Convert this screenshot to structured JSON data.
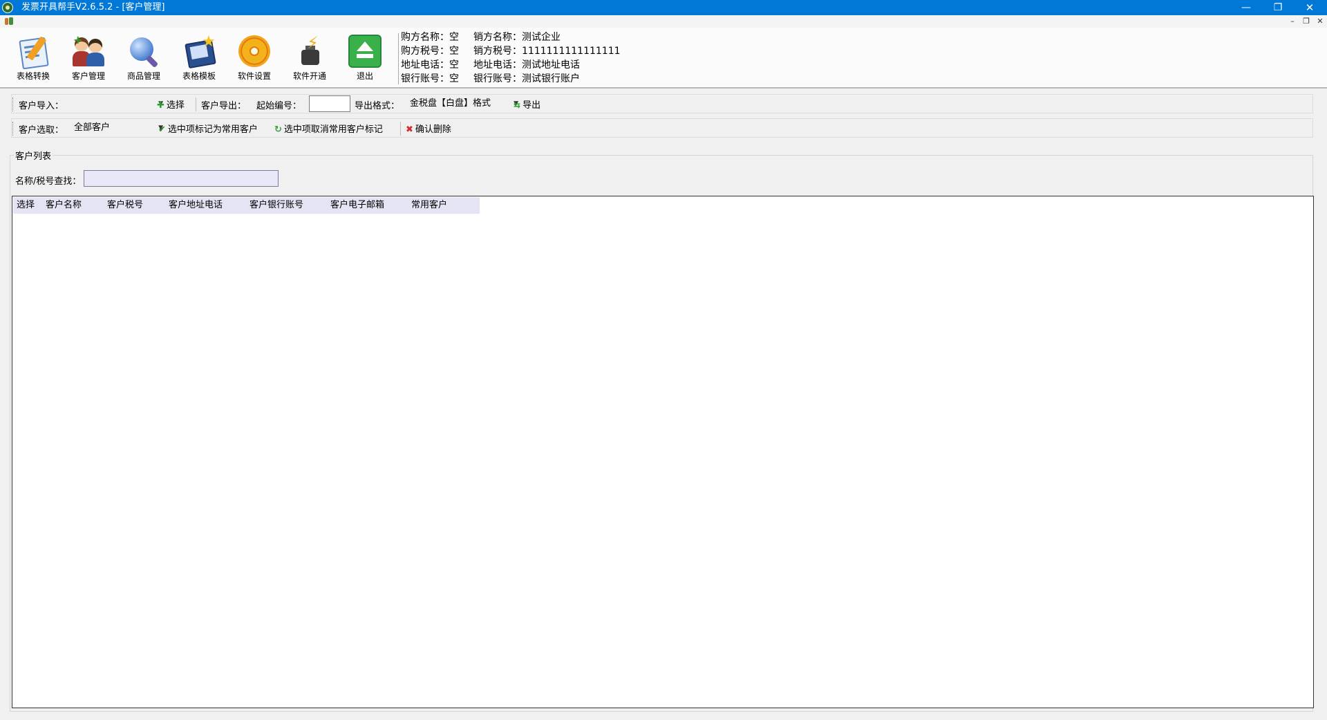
{
  "window": {
    "title": "发票开具帮手V2.6.5.2  - [客户管理]",
    "minimize_glyph": "—",
    "maximize_glyph": "❐",
    "close_glyph": "✕"
  },
  "mdi": {
    "min": "–",
    "restore": "❐",
    "close": "✕"
  },
  "toolbar": {
    "buttons": [
      {
        "label": "表格转换",
        "icon": "sheet-convert-icon"
      },
      {
        "label": "客户管理",
        "icon": "client-icon"
      },
      {
        "label": "商品管理",
        "icon": "goods-icon"
      },
      {
        "label": "表格模板",
        "icon": "template-icon"
      },
      {
        "label": "软件设置",
        "icon": "settings-gear-icon"
      },
      {
        "label": "软件开通",
        "icon": "activate-icon"
      },
      {
        "label": "退出",
        "icon": "exit-icon"
      }
    ]
  },
  "info": {
    "buyer": [
      {
        "label": "购方名称：",
        "value": "空"
      },
      {
        "label": "购方税号：",
        "value": "空"
      },
      {
        "label": "地址电话：",
        "value": "空"
      },
      {
        "label": "银行账号：",
        "value": "空"
      }
    ],
    "seller": [
      {
        "label": "销方名称：",
        "value": "测试企业"
      },
      {
        "label": "销方税号：",
        "value": "1111111111111111"
      },
      {
        "label": "地址电话：",
        "value": "测试地址电话"
      },
      {
        "label": "银行账号：",
        "value": "测试银行账户"
      }
    ]
  },
  "import_row": {
    "import_label": "客户导入：",
    "import_value": "",
    "select_btn": "选择",
    "export_label": "客户导出：",
    "start_no_label": "起始编号：",
    "start_no_value": "",
    "format_label": "导出格式：",
    "format_value": "金税盘【白盘】格式",
    "export_btn": "导出"
  },
  "pick_row": {
    "pick_label": "客户选取：",
    "pick_value": "全部客户",
    "mark_btn": "选中项标记为常用客户",
    "unmark_btn": "选中项取消常用客户标记",
    "delete_btn": "确认删除"
  },
  "list": {
    "group_title": "客户列表",
    "search_label": "名称/税号查找：",
    "search_value": "",
    "columns": [
      "选择",
      "客户名称",
      "客户税号",
      "客户地址电话",
      "客户银行账号",
      "客户电子邮箱",
      "常用客户"
    ]
  },
  "colors": {
    "titlebar": "#0078d7",
    "header": "#e4e4f4"
  }
}
